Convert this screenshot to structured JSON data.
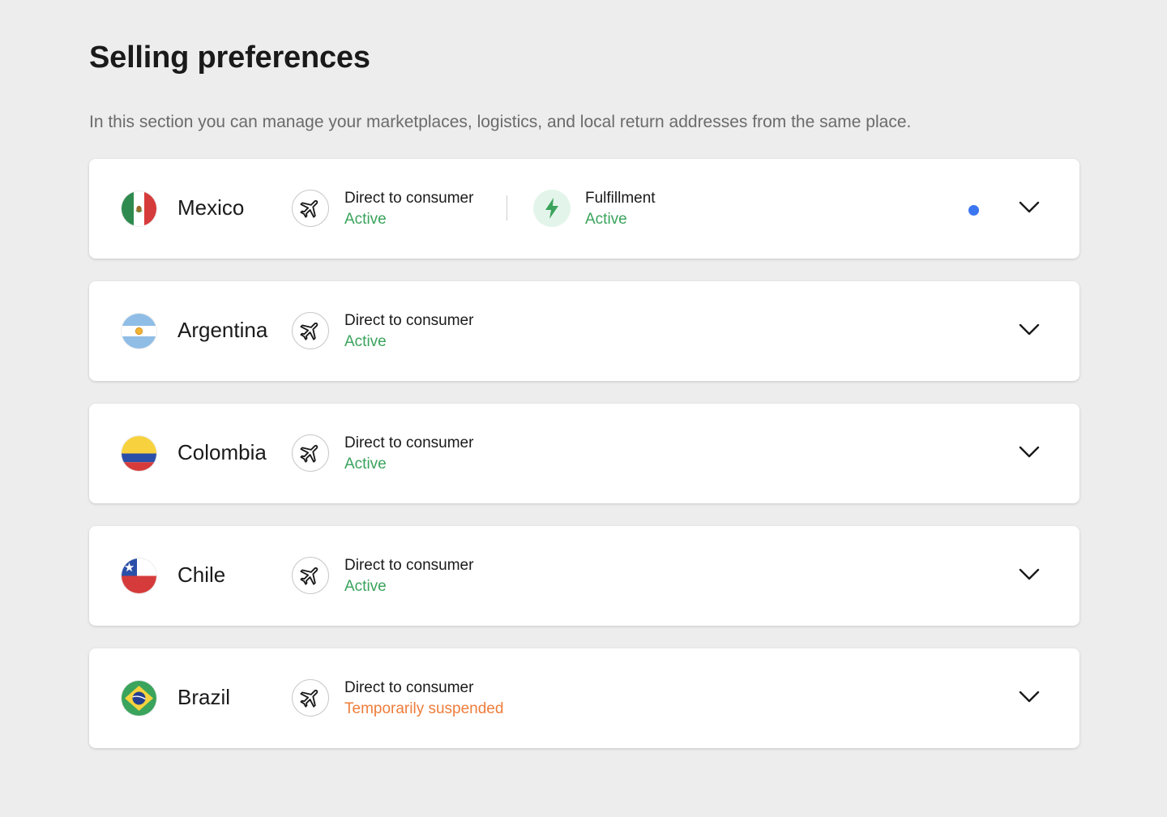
{
  "page": {
    "title": "Selling preferences",
    "description": "In this section you can manage your marketplaces, logistics, and local return addresses from the same place."
  },
  "colors": {
    "active": "#3aa35c",
    "suspended": "#ee7d3b",
    "notification": "#3c76f0"
  },
  "countries": [
    {
      "name": "Mexico",
      "flag_icon": "mexico-flag-icon",
      "direct_to_consumer": {
        "label": "Direct to consumer",
        "status": "Active",
        "icon": "airplane-icon"
      },
      "fulfillment": {
        "label": "Fulfillment",
        "status": "Active",
        "icon": "lightning-bolt-icon"
      },
      "has_notification": true,
      "expand_icon": "chevron-down-icon"
    },
    {
      "name": "Argentina",
      "flag_icon": "argentina-flag-icon",
      "direct_to_consumer": {
        "label": "Direct to consumer",
        "status": "Active",
        "icon": "airplane-icon"
      },
      "expand_icon": "chevron-down-icon"
    },
    {
      "name": "Colombia",
      "flag_icon": "colombia-flag-icon",
      "direct_to_consumer": {
        "label": "Direct to consumer",
        "status": "Active",
        "icon": "airplane-icon"
      },
      "expand_icon": "chevron-down-icon"
    },
    {
      "name": "Chile",
      "flag_icon": "chile-flag-icon",
      "direct_to_consumer": {
        "label": "Direct to consumer",
        "status": "Active",
        "icon": "airplane-icon"
      },
      "expand_icon": "chevron-down-icon"
    },
    {
      "name": "Brazil",
      "flag_icon": "brazil-flag-icon",
      "direct_to_consumer": {
        "label": "Direct to consumer",
        "status": "Temporarily suspended",
        "icon": "airplane-icon"
      },
      "expand_icon": "chevron-down-icon"
    }
  ]
}
